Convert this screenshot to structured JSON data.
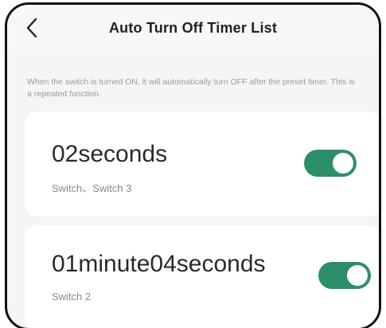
{
  "header": {
    "title": "Auto Turn Off Timer List",
    "back_icon": "chevron-left-icon"
  },
  "description": "When the switch is turned ON, it will automatically turn OFF after the preset timer. This is a repeated function.",
  "timers": [
    {
      "value": "02seconds",
      "switches": "Switch、Switch 3",
      "enabled": true
    },
    {
      "value": "01minute04seconds",
      "switches": "Switch 2",
      "enabled": true
    }
  ],
  "colors": {
    "toggle_on": "#2d8f6a",
    "background": "#f5f5f5",
    "card": "#ffffff"
  }
}
